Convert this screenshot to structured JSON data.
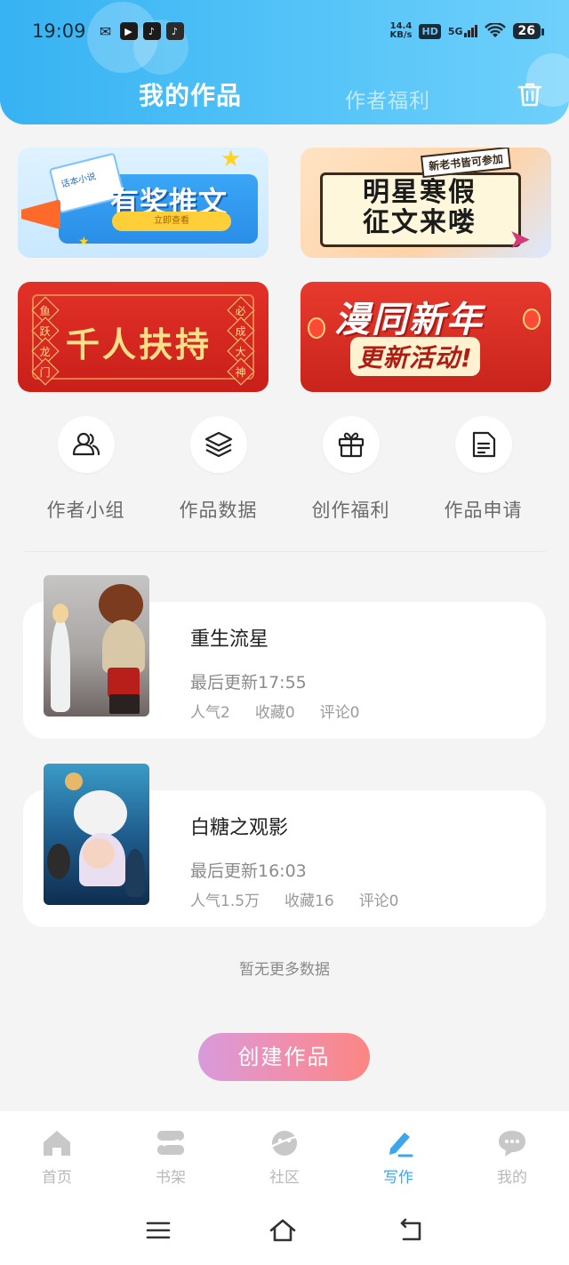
{
  "status_bar": {
    "time": "19:09",
    "speed_top": "14.4",
    "speed_bottom": "KB/s",
    "hd": "HD",
    "network": "5G",
    "battery": "26"
  },
  "header": {
    "tabs": [
      {
        "label": "我的作品",
        "active": true
      },
      {
        "label": "作者福利",
        "active": false
      }
    ],
    "trash_icon": "trash-icon"
  },
  "banners": {
    "reward": {
      "paper": "话本小说",
      "title": "有奖推文",
      "button": "立即查看"
    },
    "winter": {
      "tag": "新老书皆可参加",
      "line1": "明星寒假",
      "line2": "征文来喽"
    },
    "support": {
      "title": "千人扶持",
      "left_couplet": [
        "鱼",
        "跃",
        "龙",
        "门"
      ],
      "right_couplet": [
        "必",
        "成",
        "大",
        "神"
      ]
    },
    "newyear": {
      "title": "漫同新年",
      "subtitle": "更新活动!"
    }
  },
  "actions": [
    {
      "label": "作者小组",
      "icon": "group-icon"
    },
    {
      "label": "作品数据",
      "icon": "layers-icon"
    },
    {
      "label": "创作福利",
      "icon": "gift-icon"
    },
    {
      "label": "作品申请",
      "icon": "document-icon"
    }
  ],
  "works": [
    {
      "title": "重生流星",
      "updated": "最后更新17:55",
      "popularity": "人气2",
      "favorites": "收藏0",
      "comments": "评论0"
    },
    {
      "title": "白糖之观影",
      "updated": "最后更新16:03",
      "popularity": "人气1.5万",
      "favorites": "收藏16",
      "comments": "评论0"
    }
  ],
  "no_more": "暂无更多数据",
  "create_button": "创建作品",
  "bottom_nav": [
    {
      "label": "首页",
      "icon": "home-icon",
      "active": false
    },
    {
      "label": "书架",
      "icon": "bookshelf-icon",
      "active": false
    },
    {
      "label": "社区",
      "icon": "community-icon",
      "active": false
    },
    {
      "label": "写作",
      "icon": "write-icon",
      "active": true
    },
    {
      "label": "我的",
      "icon": "profile-icon",
      "active": false
    }
  ],
  "colors": {
    "header_blue": "#4fc1f7",
    "active_nav": "#3aa7ec",
    "create_gradient_start": "#d89bdc",
    "create_gradient_end": "#fb8682"
  }
}
